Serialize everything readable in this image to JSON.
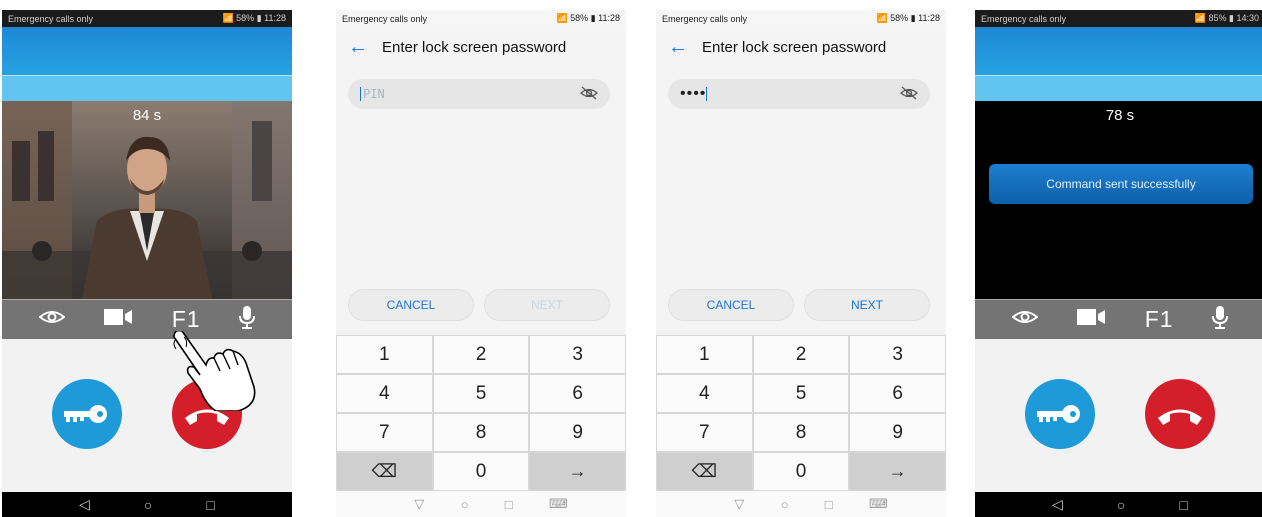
{
  "status_bar": {
    "carrier": "Emergency calls only",
    "p1_icons": "📶 58% ▮ 11:28",
    "p2_icons": "📶 58% ▮ 11:28",
    "p3_icons": "📶 58% ▮ 11:28",
    "p4_icons": "📶 85% ▮ 14:30"
  },
  "call_screen_1": {
    "timer": "84 s"
  },
  "call_screen_2": {
    "timer": "78 s",
    "toast": "Command sent successfully"
  },
  "controls": {
    "f1_label": "F1"
  },
  "password": {
    "title": "Enter lock screen password",
    "placeholder": "PIN",
    "entered": "••••",
    "cancel_label": "CANCEL",
    "next_label": "NEXT"
  },
  "keypad": [
    "1",
    "2",
    "3",
    "4",
    "5",
    "6",
    "7",
    "8",
    "9",
    "⌫",
    "0",
    "→"
  ],
  "colors": {
    "accent": "#1a73d9",
    "key_button": "#1e9ad9",
    "hangup_button": "#d41f2a",
    "header_blue": "#27a0e2"
  }
}
